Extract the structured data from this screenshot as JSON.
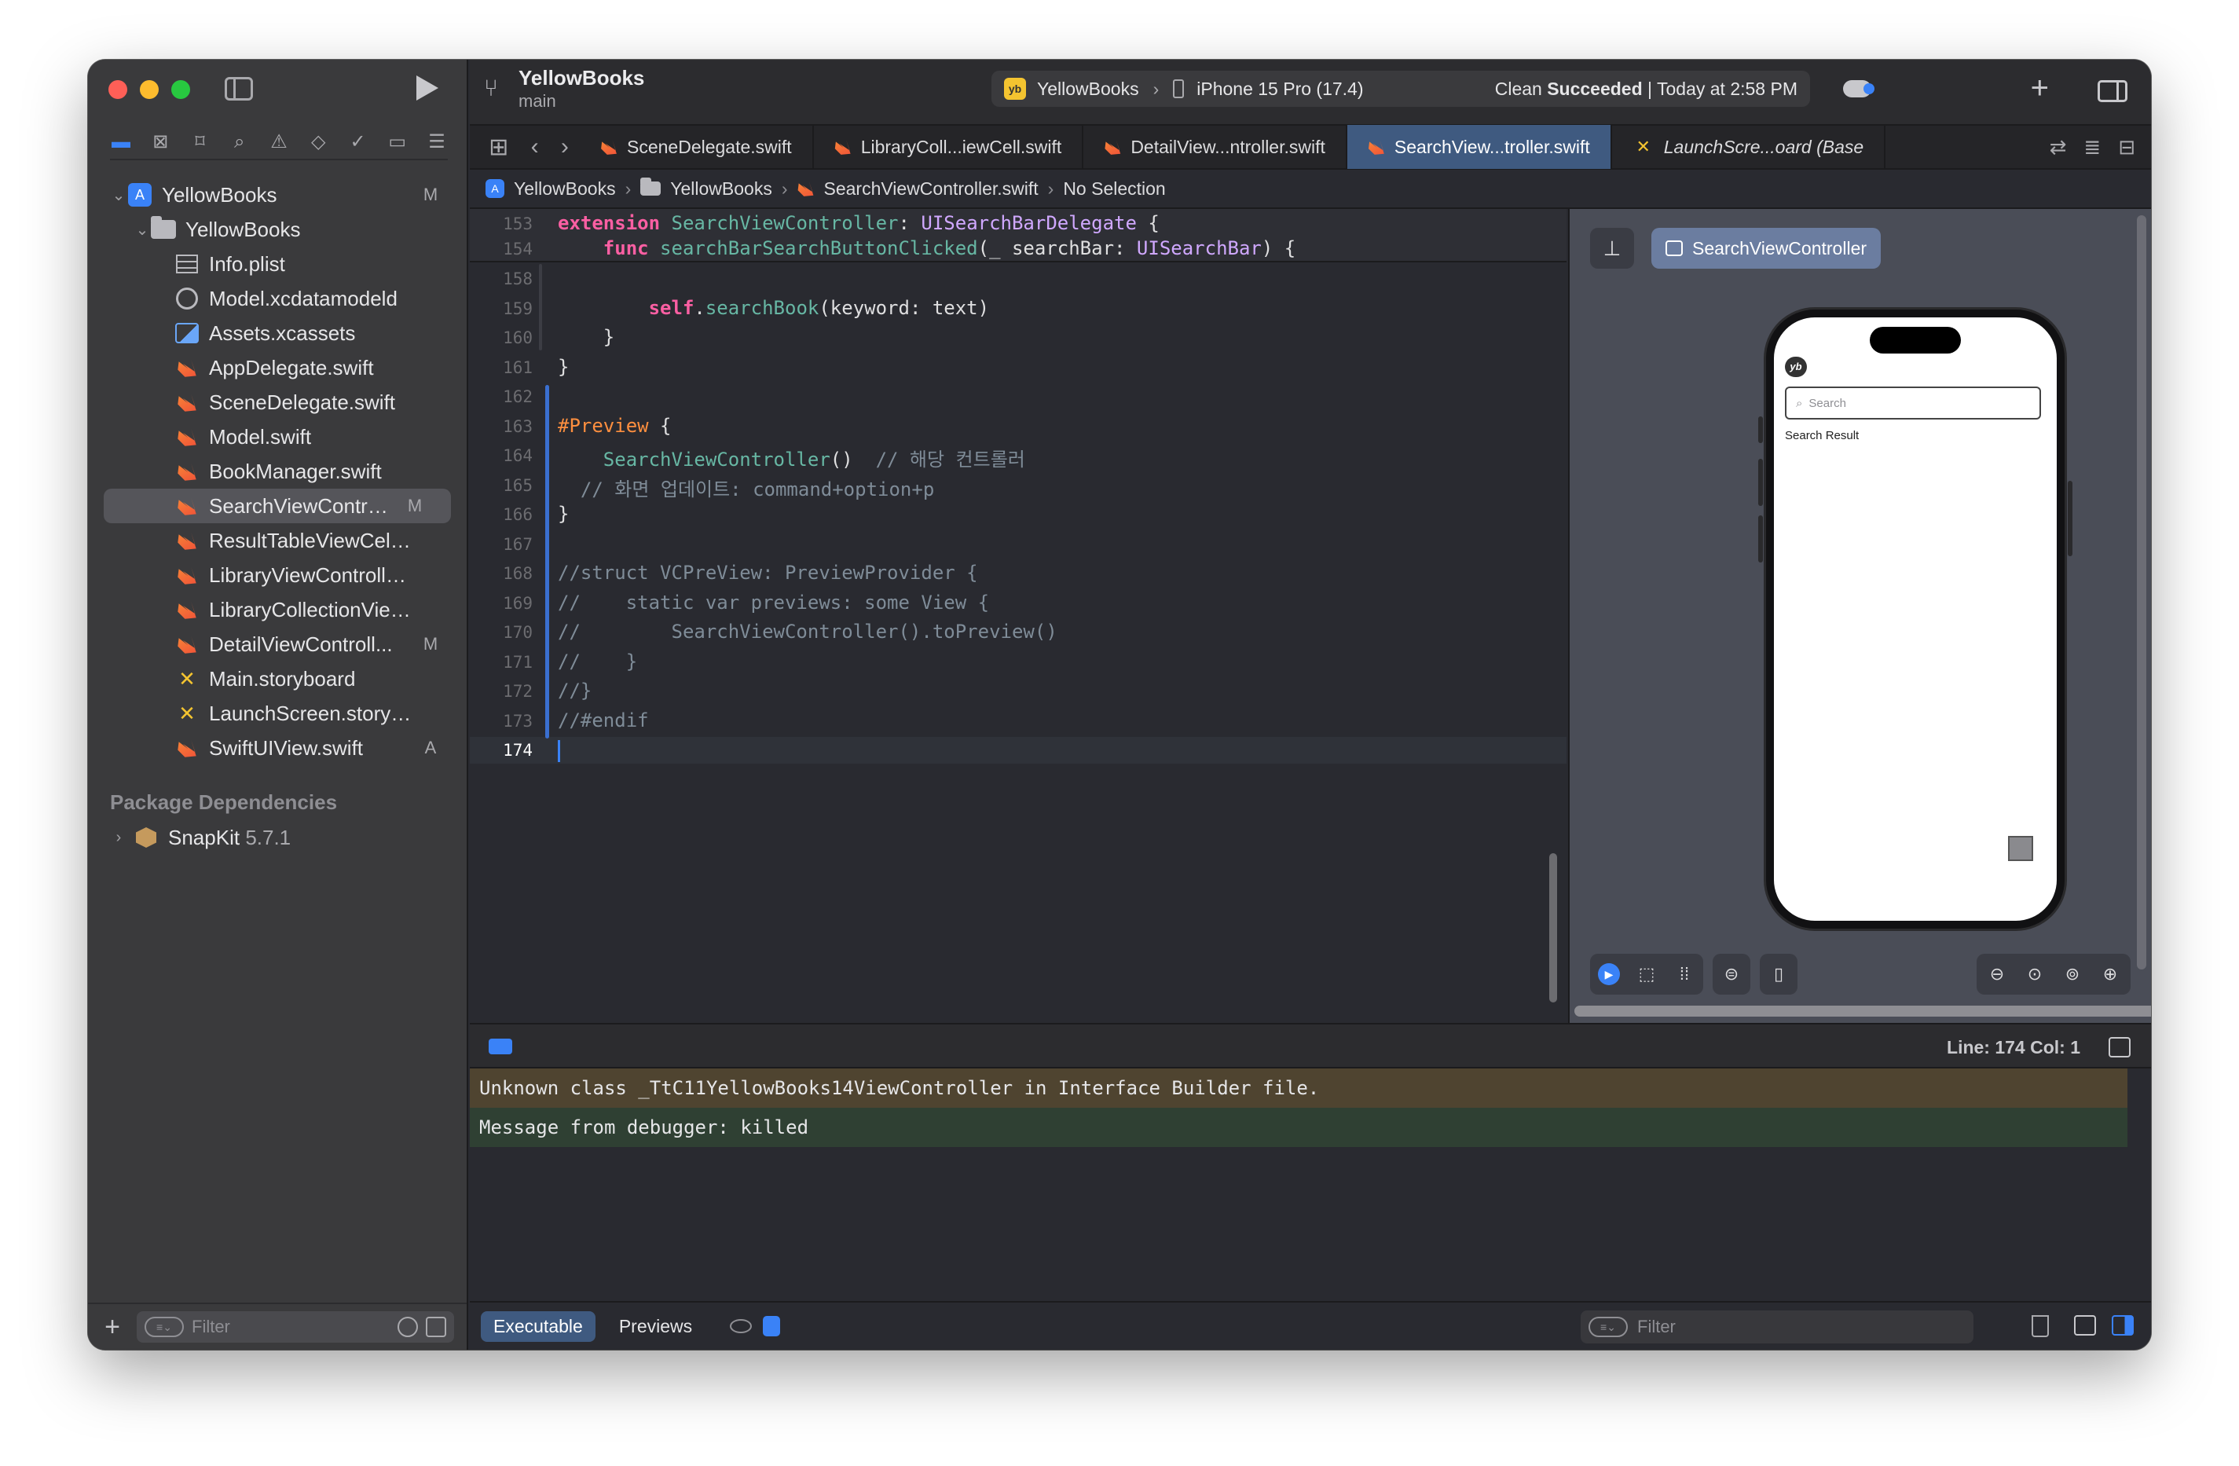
{
  "window": {
    "project_title": "YellowBooks",
    "branch": "main"
  },
  "scheme": {
    "app_icon_text": "yb",
    "target": "YellowBooks",
    "device": "iPhone 15 Pro (17.4)",
    "status_prefix": "Clean ",
    "status_bold": "Succeeded",
    "status_suffix": " | Today at 2:58 PM"
  },
  "navigator": {
    "icons": [
      "folder-icon",
      "x-square-icon",
      "bookmark-icon",
      "search-icon",
      "warning-icon",
      "diamond-icon",
      "test-icon",
      "breakpoint-icon",
      "report-icon"
    ],
    "tree": [
      {
        "name": "YellowBooks",
        "badge": "M",
        "level": 0,
        "kind": "project",
        "expanded": true
      },
      {
        "name": "YellowBooks",
        "badge": "",
        "level": 1,
        "kind": "folder",
        "expanded": true
      },
      {
        "name": "Info.plist",
        "badge": "",
        "level": 2,
        "kind": "plist"
      },
      {
        "name": "Model.xcdatamodeld",
        "badge": "",
        "level": 2,
        "kind": "xcdatamodel"
      },
      {
        "name": "Assets.xcassets",
        "badge": "",
        "level": 2,
        "kind": "assets"
      },
      {
        "name": "AppDelegate.swift",
        "badge": "",
        "level": 2,
        "kind": "swift"
      },
      {
        "name": "SceneDelegate.swift",
        "badge": "",
        "level": 2,
        "kind": "swift"
      },
      {
        "name": "Model.swift",
        "badge": "",
        "level": 2,
        "kind": "swift"
      },
      {
        "name": "BookManager.swift",
        "badge": "",
        "level": 2,
        "kind": "swift"
      },
      {
        "name": "SearchViewControll...",
        "badge": "M",
        "level": 2,
        "kind": "swift",
        "selected": true
      },
      {
        "name": "ResultTableViewCell.s...",
        "badge": "",
        "level": 2,
        "kind": "swift"
      },
      {
        "name": "LibraryViewController....",
        "badge": "",
        "level": 2,
        "kind": "swift"
      },
      {
        "name": "LibraryCollectionView...",
        "badge": "",
        "level": 2,
        "kind": "swift"
      },
      {
        "name": "DetailViewControll...",
        "badge": "M",
        "level": 2,
        "kind": "swift"
      },
      {
        "name": "Main.storyboard",
        "badge": "",
        "level": 2,
        "kind": "storyboard"
      },
      {
        "name": "LaunchScreen.storybo...",
        "badge": "",
        "level": 2,
        "kind": "storyboard"
      },
      {
        "name": "SwiftUIView.swift",
        "badge": "A",
        "level": 2,
        "kind": "swift"
      }
    ],
    "package_section": "Package Dependencies",
    "package": {
      "name": "SnapKit",
      "version": "5.7.1"
    },
    "filter_placeholder": "Filter"
  },
  "tabs": [
    {
      "label": "SceneDelegate.swift",
      "kind": "swift",
      "active": false
    },
    {
      "label": "LibraryColl...iewCell.swift",
      "kind": "swift",
      "active": false
    },
    {
      "label": "DetailView...ntroller.swift",
      "kind": "swift",
      "active": false
    },
    {
      "label": "SearchView...troller.swift",
      "kind": "swift",
      "active": true
    },
    {
      "label": "LaunchScre...oard (Base",
      "kind": "storyboard",
      "active": false
    }
  ],
  "jumpbar": {
    "project": "YellowBooks",
    "group": "YellowBooks",
    "file": "SearchViewController.swift",
    "selection": "No Selection"
  },
  "editor": {
    "sticky_lines": [
      {
        "num": "153",
        "html": "<span class=\"kw\">extension</span> <span class=\"prop\">SearchViewController</span>: <span class=\"ty\">UISearchBarDelegate</span> {"
      },
      {
        "num": "154",
        "html": "    <span class=\"kw\">func</span> <span class=\"fn\">searchBarSearchButtonClicked</span>(_ searchBar: <span class=\"ty\">UISearchBar</span>) {"
      }
    ],
    "lines": [
      {
        "num": "158",
        "html": ""
      },
      {
        "num": "159",
        "html": "        <span class=\"kw\">self</span>.<span class=\"prop\">searchBook</span>(keyword: text)"
      },
      {
        "num": "160",
        "html": "    }"
      },
      {
        "num": "161",
        "html": "}"
      },
      {
        "num": "162",
        "html": ""
      },
      {
        "num": "163",
        "html": "<span class=\"mac\">#Preview</span> {"
      },
      {
        "num": "164",
        "html": "    <span class=\"prop\">SearchViewController</span>()  <span class=\"cm\">// 해당 컨트롤러</span>"
      },
      {
        "num": "165",
        "html": "  <span class=\"cm\">// 화면 업데이트: command+option+p</span>"
      },
      {
        "num": "166",
        "html": "}"
      },
      {
        "num": "167",
        "html": ""
      },
      {
        "num": "168",
        "html": "<span class=\"cm\">//struct VCPreView: PreviewProvider {</span>"
      },
      {
        "num": "169",
        "html": "<span class=\"cm\">//    static var previews: some View {</span>"
      },
      {
        "num": "170",
        "html": "<span class=\"cm\">//        SearchViewController().toPreview()</span>"
      },
      {
        "num": "171",
        "html": "<span class=\"cm\">//    }</span>"
      },
      {
        "num": "172",
        "html": "<span class=\"cm\">//}</span>"
      },
      {
        "num": "173",
        "html": "<span class=\"cm\">//#endif</span>"
      },
      {
        "num": "174",
        "html": "",
        "current": true
      }
    ]
  },
  "canvas": {
    "preview_name": "SearchViewController",
    "app_logo": "yb",
    "search_placeholder": "Search",
    "search_result_label": "Search Result"
  },
  "debug": {
    "line_col": "Line: 174  Col: 1",
    "console": [
      {
        "text": "Unknown class _TtC11YellowBooks14ViewController in Interface Builder file.",
        "type": "warn"
      },
      {
        "text": "Message from debugger: killed",
        "type": "ok"
      }
    ],
    "segments": [
      "Executable",
      "Previews"
    ],
    "filter_placeholder": "Filter"
  }
}
